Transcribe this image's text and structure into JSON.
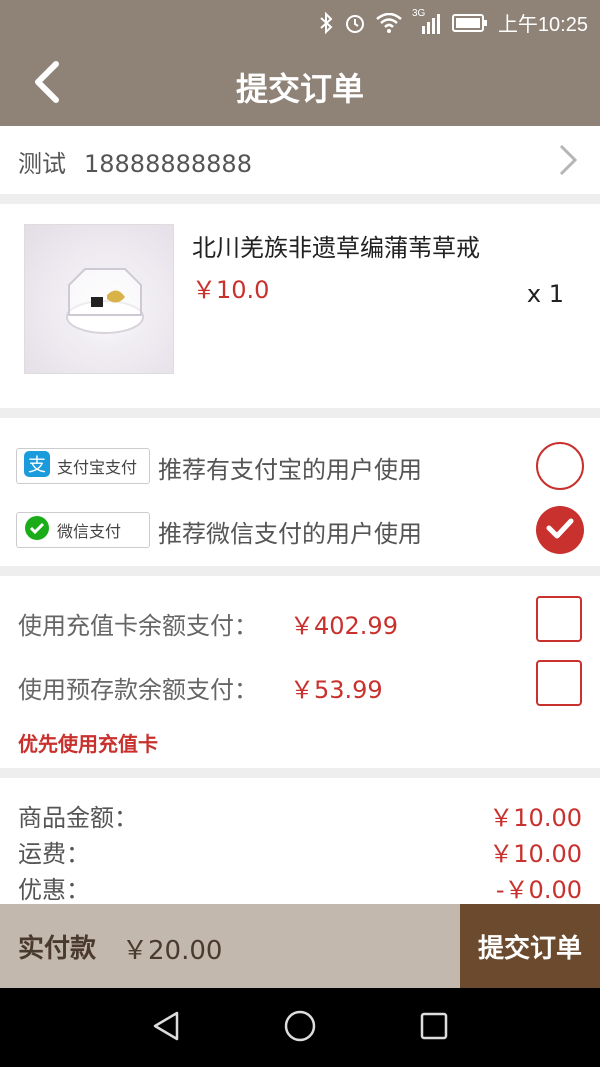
{
  "status_bar": {
    "network": "3G",
    "time": "上午10:25"
  },
  "header": {
    "title": "提交订单"
  },
  "address": {
    "name": "测试",
    "phone": "18888888888"
  },
  "product": {
    "name": "北川羌族非遗草编蒲苇草戒",
    "price": "￥10.0",
    "quantity": "x 1"
  },
  "payment": {
    "options": [
      {
        "badge": "支付宝支付",
        "description": "推荐有支付宝的用户使用",
        "selected": false
      },
      {
        "badge": "微信支付",
        "description": "推荐微信支付的用户使用",
        "selected": true
      }
    ]
  },
  "balance": {
    "rows": [
      {
        "label": "使用充值卡余额支付：",
        "amount": "￥402.99"
      },
      {
        "label": "使用预存款余额支付：",
        "amount": "￥53.99"
      }
    ],
    "note": "优先使用充值卡"
  },
  "summary": {
    "rows": [
      {
        "label": "商品金额：",
        "value": "￥10.00"
      },
      {
        "label": "运费：",
        "value": "￥10.00"
      },
      {
        "label": "优惠：",
        "value": "-￥0.00"
      }
    ]
  },
  "footer": {
    "paid_label": "实付款",
    "paid_amount": "￥20.00",
    "submit": "提交订单"
  },
  "colors": {
    "header": "#8f8378",
    "accent_red": "#c8312d",
    "submit_button": "#6b4a2e",
    "footer": "#c3b8ae"
  },
  "icons": [
    "bluetooth-icon",
    "alarm-icon",
    "wifi-icon",
    "signal-icon",
    "battery-icon",
    "back-arrow-icon",
    "chevron-right-icon",
    "alipay-icon",
    "wechat-pay-icon",
    "check-icon",
    "nav-back-icon",
    "nav-home-icon",
    "nav-recent-icon"
  ]
}
